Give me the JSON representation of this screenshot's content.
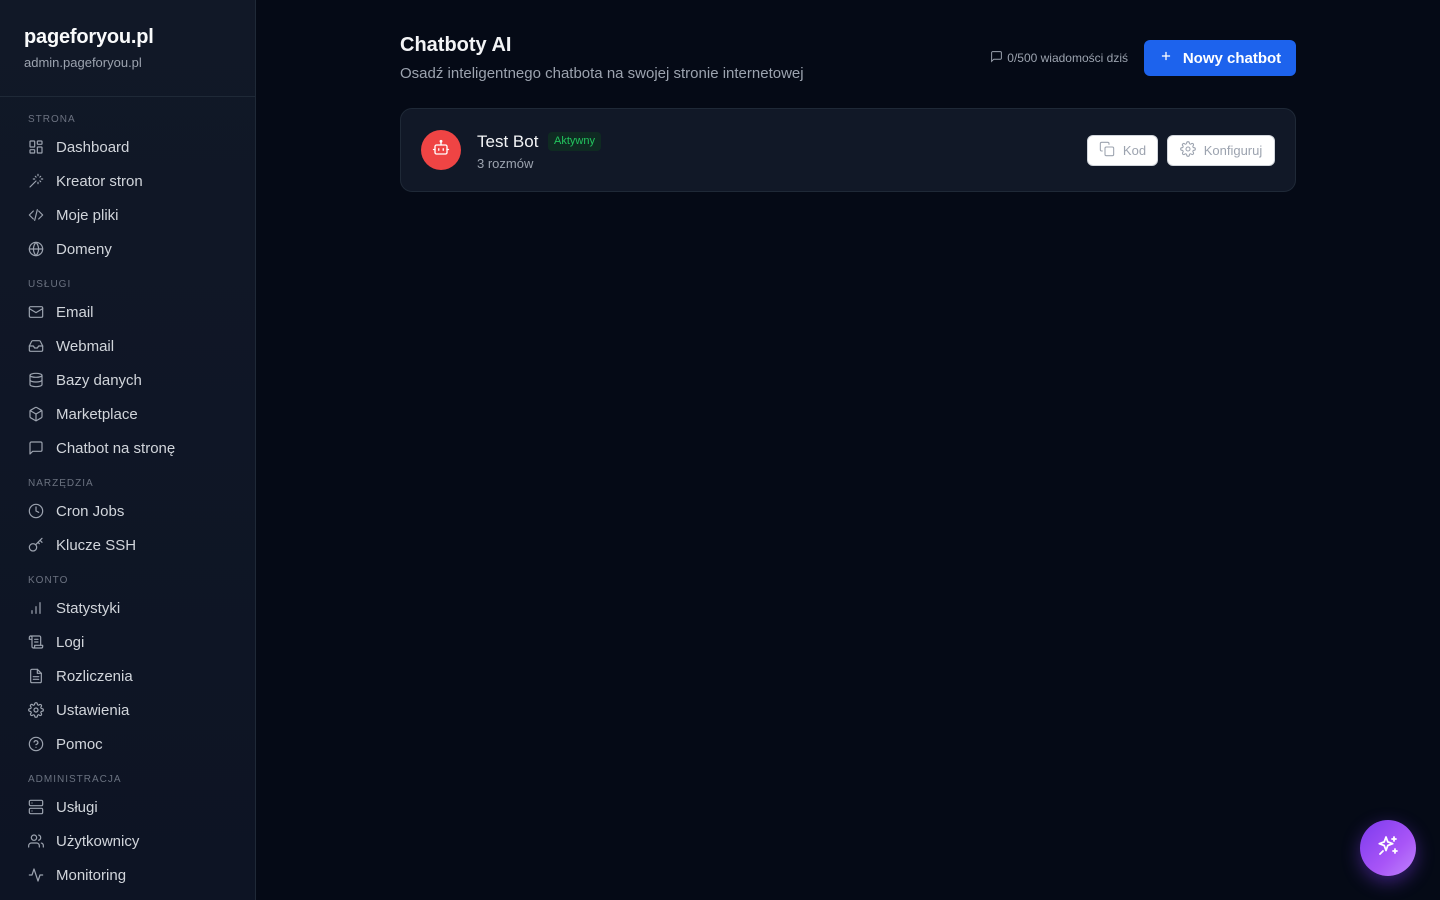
{
  "brand": {
    "title": "pageforyou.pl",
    "subtitle": "admin.pageforyou.pl"
  },
  "sidebar": {
    "sections": [
      {
        "label": "STRONA",
        "items": [
          {
            "label": "Dashboard",
            "icon": "grid-icon"
          },
          {
            "label": "Kreator stron",
            "icon": "magic-wand-icon"
          },
          {
            "label": "Moje pliki",
            "icon": "code-icon"
          },
          {
            "label": "Domeny",
            "icon": "globe-icon"
          }
        ]
      },
      {
        "label": "USŁUGI",
        "items": [
          {
            "label": "Email",
            "icon": "mail-icon"
          },
          {
            "label": "Webmail",
            "icon": "inbox-icon"
          },
          {
            "label": "Bazy danych",
            "icon": "database-icon"
          },
          {
            "label": "Marketplace",
            "icon": "package-icon"
          },
          {
            "label": "Chatbot na stronę",
            "icon": "message-square-icon"
          }
        ]
      },
      {
        "label": "NARZĘDZIA",
        "items": [
          {
            "label": "Cron Jobs",
            "icon": "clock-icon"
          },
          {
            "label": "Klucze SSH",
            "icon": "key-icon"
          }
        ]
      },
      {
        "label": "KONTO",
        "items": [
          {
            "label": "Statystyki",
            "icon": "bar-chart-icon"
          },
          {
            "label": "Logi",
            "icon": "scroll-icon"
          },
          {
            "label": "Rozliczenia",
            "icon": "file-text-icon"
          },
          {
            "label": "Ustawienia",
            "icon": "gear-icon"
          },
          {
            "label": "Pomoc",
            "icon": "help-circle-icon"
          }
        ]
      },
      {
        "label": "ADMINISTRACJA",
        "items": [
          {
            "label": "Usługi",
            "icon": "server-icon"
          },
          {
            "label": "Użytkownicy",
            "icon": "users-icon"
          },
          {
            "label": "Monitoring",
            "icon": "activity-icon"
          }
        ]
      }
    ]
  },
  "header": {
    "title": "Chatboty AI",
    "subtitle": "Osadź inteligentnego chatbota na swojej stronie internetowej",
    "usage": "0/500 wiadomości dziś",
    "new_button": "Nowy chatbot"
  },
  "chatbots": [
    {
      "name": "Test Bot",
      "status": "Aktywny",
      "meta": "3 rozmów",
      "code_label": "Kod",
      "config_label": "Konfiguruj",
      "avatar_color": "#ef4444"
    }
  ],
  "colors": {
    "accent": "#1d63ed",
    "active": "#22c55e",
    "fab": "#8b5cf6"
  }
}
